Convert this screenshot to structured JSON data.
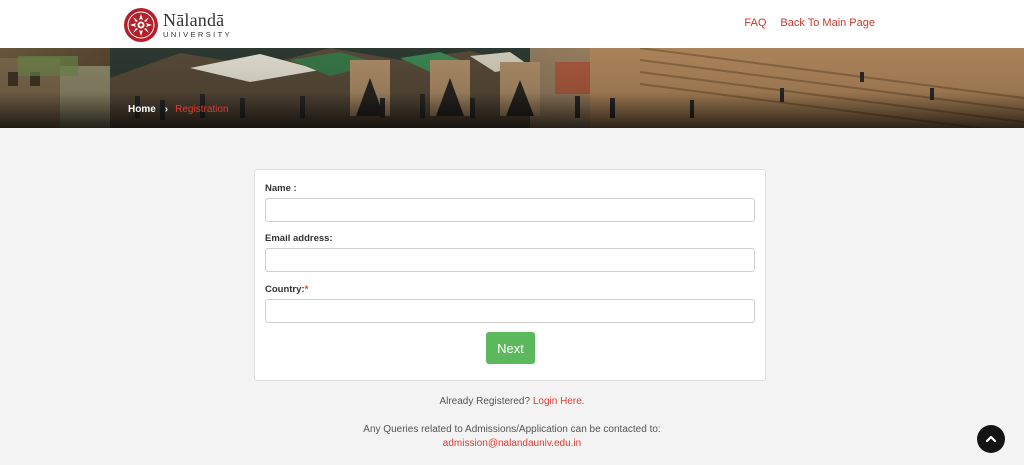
{
  "header": {
    "logo_name": "Nālandā",
    "logo_sub": "UNIVERSITY",
    "nav": {
      "faq": "FAQ",
      "back": "Back To Main Page"
    }
  },
  "breadcrumb": {
    "home": "Home",
    "separator": "›",
    "current": "Registration"
  },
  "form": {
    "name_label": "Name :",
    "email_label": "Email address:",
    "country_label": "Country:",
    "required_mark": "*",
    "name_value": "",
    "email_value": "",
    "country_value": "",
    "next_label": "Next"
  },
  "footer": {
    "registered_text": "Already Registered?",
    "login_link": "Login Here.",
    "queries_text": "Any Queries related to Admissions/Application can be contacted to:",
    "email": "admission@nalandauniv.edu.in"
  },
  "colors": {
    "accent": "#e03b2f",
    "brand": "#b3202a",
    "button": "#5cb85c"
  },
  "icons": {
    "scroll_top": "chevron-up-icon",
    "breadcrumb_sep": "chevron-right-icon",
    "logo": "nalanda-emblem-icon"
  }
}
